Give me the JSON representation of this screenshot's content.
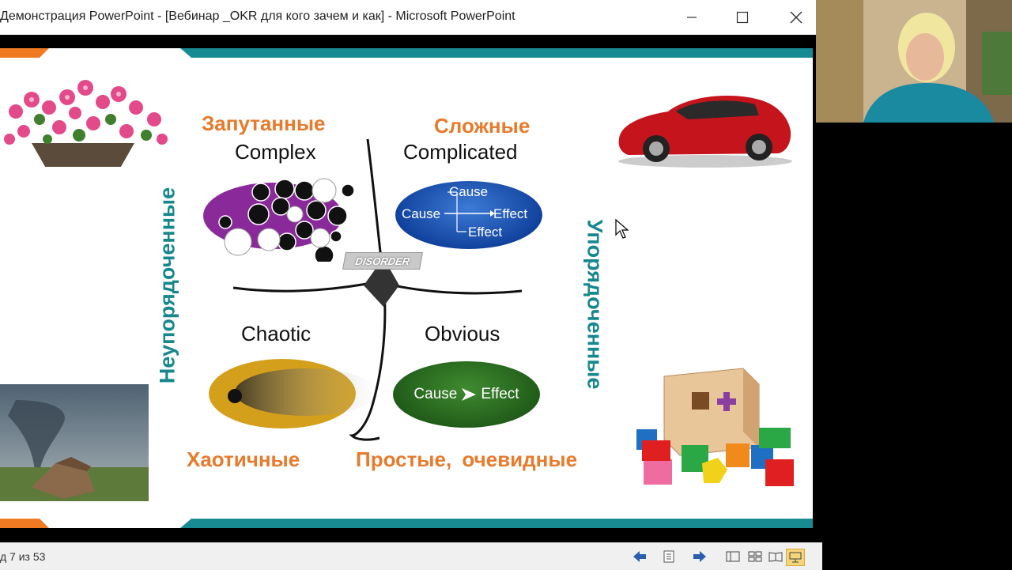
{
  "window": {
    "title": "Демонстрация PowerPoint - [Вебинар _OKR для кого зачем и как] - Microsoft PowerPoint",
    "controls": [
      "minimize-icon",
      "maximize-icon",
      "close-icon"
    ]
  },
  "slide": {
    "quadrants": {
      "complex": {
        "ru": "Запутанные",
        "en": "Complex"
      },
      "complicated": {
        "ru": "Сложные",
        "en": "Complicated"
      },
      "chaotic": {
        "ru": "Хаотичные",
        "en": "Chaotic"
      },
      "obvious": {
        "ru": "Простые, очевидные",
        "en": "Obvious"
      }
    },
    "side_labels": {
      "left": "Неупорядоченные",
      "right": "Упорядоченные"
    },
    "disorder_label": "DISORDER",
    "complicated_diagram": {
      "cause_left": "Cause",
      "cause_top": "Cause",
      "effect_right": "Effect",
      "effect_bottom": "Effect"
    },
    "obvious_diagram": {
      "cause": "Cause",
      "effect": "Effect"
    },
    "colors": {
      "teal": "#188b92",
      "orange": "#e87a2c"
    }
  },
  "statusbar": {
    "slide_counter": "д 7 из 53",
    "buttons": [
      "previous-slide-icon",
      "slide-menu-icon",
      "next-slide-icon",
      "normal-view-icon",
      "slide-sorter-icon",
      "reading-view-icon",
      "slideshow-icon"
    ]
  }
}
